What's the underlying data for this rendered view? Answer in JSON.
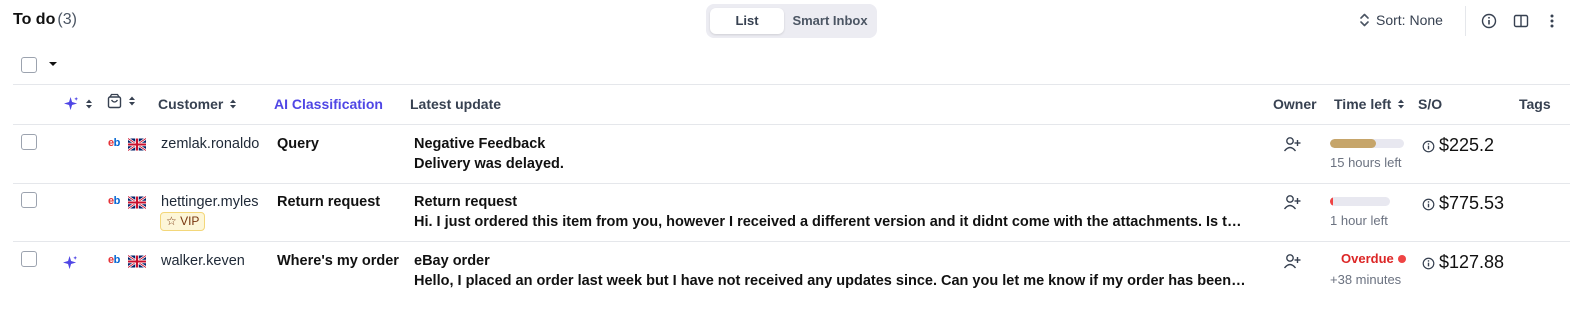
{
  "header": {
    "title": "To do",
    "count": "(3)",
    "view_tabs": [
      {
        "label": "List",
        "active": true
      },
      {
        "label": "Smart Inbox",
        "active": false
      }
    ],
    "sort_label": "Sort: None",
    "icons": [
      "sort-icon",
      "info-icon",
      "columns-icon",
      "more-vertical-icon"
    ]
  },
  "columns": {
    "customer": "Customer",
    "ai_classification": "AI Classification",
    "latest_update": "Latest update",
    "owner": "Owner",
    "time_left": "Time left",
    "so": "S/O",
    "tags": "Tags"
  },
  "colors": {
    "accent": "#4f46e5",
    "progress_warning": "#c6a56a",
    "progress_danger": "#ef4444",
    "overdue": "#dc2626",
    "vip_bg": "#fdf6d8"
  },
  "rows": [
    {
      "ai_flag": false,
      "channel": "eBay",
      "country": "UK",
      "customer": "zemlak.ronaldo",
      "vip": null,
      "classification": "Query",
      "update_title": "Negative Feedback",
      "update_body": "Delivery was delayed.",
      "time_left_label": "15 hours left",
      "time_left_fraction": 0.62,
      "overdue": false,
      "amount": "$225.2"
    },
    {
      "ai_flag": false,
      "channel": "eBay",
      "country": "UK",
      "customer": "hettinger.myles",
      "vip": "☆ VIP",
      "classification": "Return request",
      "update_title": "Return request",
      "update_body": "Hi. I just ordered this item from you, however I received a different version and it didnt come with the attachments. Is there…",
      "time_left_label": "1 hour left",
      "time_left_fraction": 0.05,
      "overdue": false,
      "amount": "$775.53"
    },
    {
      "ai_flag": true,
      "channel": "eBay",
      "country": "UK",
      "customer": "walker.keven",
      "vip": null,
      "classification": "Where's my order",
      "update_title": "eBay order",
      "update_body": "Hello, I placed an order last week but I have not received any updates since. Can you let me know if my order has been…",
      "overdue": true,
      "overdue_label": "Overdue",
      "overdue_sub": "+38 minutes",
      "amount": "$127.88"
    }
  ]
}
